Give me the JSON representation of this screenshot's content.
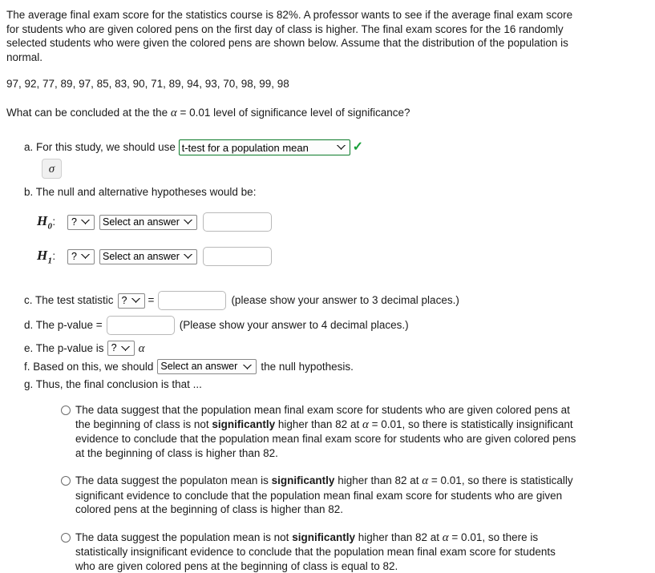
{
  "problem": {
    "intro": "The average final exam score for the statistics course is 82%. A professor wants to see if the average final exam score for students who are given colored pens on the first day of class is higher. The final exam scores for the 16 randomly selected students who were given the colored pens are shown below. Assume that the distribution of the population is normal.",
    "data_values": "97, 92, 77, 89, 97, 85, 83, 90, 71, 89, 94, 93, 70, 98, 99, 98",
    "question_prefix": "What can be concluded at the the ",
    "alpha_symbol": "α",
    "question_suffix": " = 0.01 level of significance level of significance?"
  },
  "parts": {
    "a": {
      "label": "a. For this study, we should use",
      "selected_test": "t-test for a population mean",
      "correct_mark": "✓",
      "sigma_button_label": "σ",
      "border_color": "#0c7b2a",
      "check_color": "#18a03a"
    },
    "b": {
      "label": "b. The null and alternative hypotheses would be:",
      "null_symbol": "H",
      "null_subscript": "0",
      "alt_symbol": "H",
      "alt_subscript": "1",
      "colon": ":",
      "param_placeholder": "?",
      "operator_placeholder": "Select an answer",
      "null_value": "",
      "alt_value": ""
    },
    "c": {
      "label": "c. The test statistic",
      "statistic_placeholder": "?",
      "equals": "=",
      "value": "",
      "hint": "(please show your answer to 3 decimal places.)"
    },
    "d": {
      "label": "d. The p-value =",
      "value": "",
      "hint": "(Please show your answer to 4 decimal places.)"
    },
    "e": {
      "label": "e. The p-value is",
      "comparison_placeholder": "?",
      "alpha_symbol": "α"
    },
    "f": {
      "label_before": "f. Based on this, we should",
      "decision_placeholder": "Select an answer",
      "label_after": "the null hypothesis."
    },
    "g": {
      "label": "g. Thus, the final conclusion is that ..."
    }
  },
  "conclusion_options": [
    {
      "segments": [
        {
          "text": "The data suggest that the population mean final exam score for students who are given colored pens at the beginning of class is not ",
          "bold": false
        },
        {
          "text": "significantly",
          "bold": true
        },
        {
          "text": " higher than 82 at ",
          "bold": false
        },
        {
          "text": "α",
          "bold": false,
          "math": true
        },
        {
          "text": " = 0.01, so there is statistically insignificant evidence to conclude that the population mean final exam score for students who are given colored pens at the beginning of class is higher than 82.",
          "bold": false
        }
      ]
    },
    {
      "segments": [
        {
          "text": "The data suggest the populaton mean is ",
          "bold": false
        },
        {
          "text": "significantly",
          "bold": true
        },
        {
          "text": " higher than 82 at ",
          "bold": false
        },
        {
          "text": "α",
          "bold": false,
          "math": true
        },
        {
          "text": " = 0.01, so there is statistically significant evidence to conclude that the population mean final exam score for students who are given colored pens at the beginning of class is higher than 82.",
          "bold": false
        }
      ]
    },
    {
      "segments": [
        {
          "text": "The data suggest the population mean is not ",
          "bold": false
        },
        {
          "text": "significantly",
          "bold": true
        },
        {
          "text": " higher than 82 at ",
          "bold": false
        },
        {
          "text": "α",
          "bold": false,
          "math": true
        },
        {
          "text": " = 0.01, so there is statistically insignificant evidence to conclude that the population mean final exam score for students who are given colored pens at the beginning of class is equal to 82.",
          "bold": false
        }
      ]
    }
  ]
}
